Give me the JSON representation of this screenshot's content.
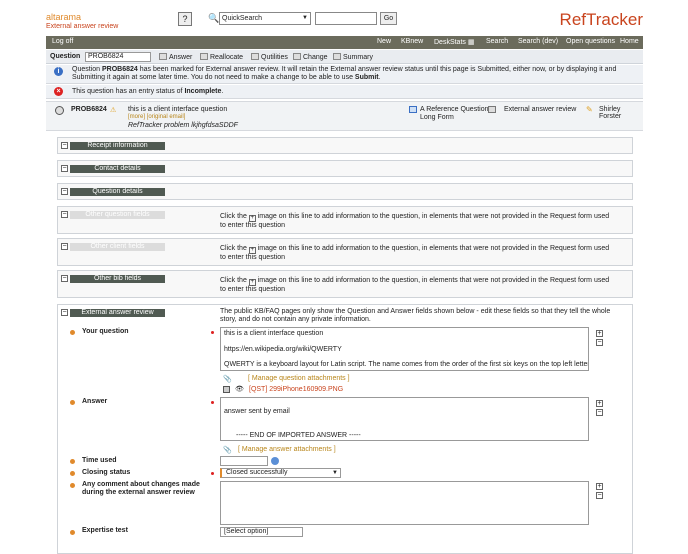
{
  "header": {
    "logo_brand": "altarama",
    "logo_sub": "External answer review",
    "search_type": "QuickSearch",
    "search_value": "",
    "go_label": "Go",
    "brand": "RefTracker"
  },
  "navbar": {
    "logoff": "Log off",
    "items": [
      "New",
      "KBnew",
      "DeskStats",
      "Search",
      "Search (dev)",
      "Open questions",
      "Home"
    ]
  },
  "question_bar": {
    "label": "Question",
    "value": "PROB6824",
    "actions": [
      "Answer",
      "Reallocate",
      "Qutilities",
      "Change",
      "Summary"
    ]
  },
  "messages": {
    "info_pre": "Question ",
    "info_id": "PROB6824",
    "info_rest": " has been marked for External answer review. It will retain the External answer review status until this page is Submitted, either now, or by displaying it and Submitting it again at some later time. You do not need to make a change to be able to use ",
    "info_submit": "Submit",
    "info_end": ".",
    "warn_pre": "This question has an entry status of ",
    "warn_status": "Incomplete",
    "warn_end": "."
  },
  "problem": {
    "id": "PROB6824",
    "summary": "this is a client interface question",
    "links": "[more]  [original email]",
    "subtitle": "RefTracker problem lkjhgfdsaSDDF",
    "type_line1": "A Reference Question -",
    "type_line2": "Long Form",
    "status": "External answer review",
    "staff": "Shirley Forster"
  },
  "sections": {
    "receipt": "Receipt information",
    "contact": "Contact details",
    "question": "Question details",
    "other_question": "Other question fields",
    "other_client": "Other client fields",
    "other_bib": "Other bib fields",
    "external": "External answer review",
    "click_pre": "Click the",
    "click_post": "image on this line to add information to the question, in elements that were not provided in the Request form used to enter this question",
    "external_desc": "The public KB/FAQ pages only show the Question and Answer fields shown below - edit these fields so that they tell the whole story, and do not contain any private information."
  },
  "form": {
    "your_question_label": "Your question",
    "your_question_line1": "this is a client interface question",
    "your_question_line2": "https://en.wikipedia.org/wiki/QWERTY",
    "your_question_line3": "QWERTY is a keyboard layout for Latin script. The name comes from the order of the first six keys on the top left letter",
    "manage_question_attachments": "[ Manage question attachments ]",
    "attachment_file": "[QST] 299iPhone160909.PNG",
    "answer_label": "Answer",
    "answer_line1": "answer sent by email",
    "answer_line2": "----- END OF IMPORTED ANSWER -----",
    "manage_answer_attachments": "[ Manage answer attachments ]",
    "time_used_label": "Time used",
    "time_used_value": "",
    "closing_status_label": "Closing status",
    "closing_status_value": "Closed successfully",
    "comment_label": "Any comment about changes made during the external answer review",
    "comment_value": "",
    "expertise_label": "Expertise test",
    "expertise_value": "[Select option]"
  },
  "colors": {
    "brand": "#c9441e",
    "accent": "#e08a2c",
    "navbar": "#6b6b5c",
    "section_header": "#505a52"
  }
}
